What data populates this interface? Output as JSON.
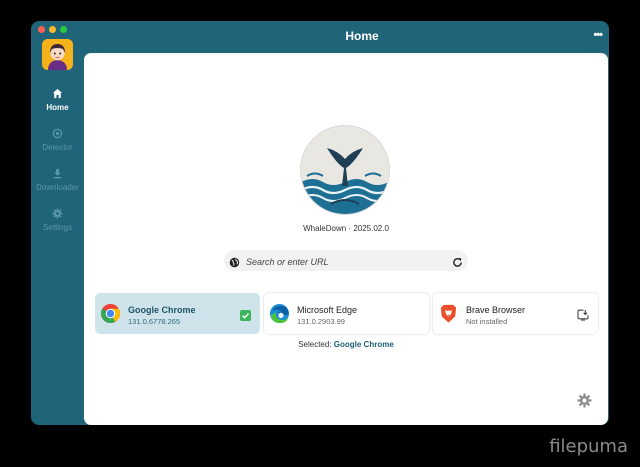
{
  "window": {
    "title": "Home",
    "more_icon": "ellipsis-icon"
  },
  "sidebar": {
    "items": [
      {
        "label": "Home",
        "icon": "home-icon",
        "active": true
      },
      {
        "label": "Detector",
        "icon": "target-icon",
        "active": false
      },
      {
        "label": "Downloader",
        "icon": "download-icon",
        "active": false
      },
      {
        "label": "Settings",
        "icon": "gear-icon",
        "active": false
      }
    ]
  },
  "app": {
    "version_text": "WhaleDown · 2025.02.0"
  },
  "search": {
    "placeholder": "Search or enter URL"
  },
  "browsers": [
    {
      "name": "Google Chrome",
      "version": "131.0.6778.265",
      "selected": true,
      "icon": "chrome-icon",
      "status_icon": "checkbox-checked-icon"
    },
    {
      "name": "Microsoft Edge",
      "version": "131.0.2903.99",
      "selected": false,
      "icon": "edge-icon"
    },
    {
      "name": "Brave Browser",
      "version": "Not installed",
      "selected": false,
      "icon": "brave-icon",
      "status_icon": "install-icon"
    }
  ],
  "selection": {
    "label": "Selected:",
    "value": "Google Chrome"
  },
  "watermark": "filepuma",
  "colors": {
    "sidebar": "#1f6478",
    "accent": "#1d5f75",
    "selected_card": "#cfe4ea",
    "check": "#3bb55c"
  }
}
